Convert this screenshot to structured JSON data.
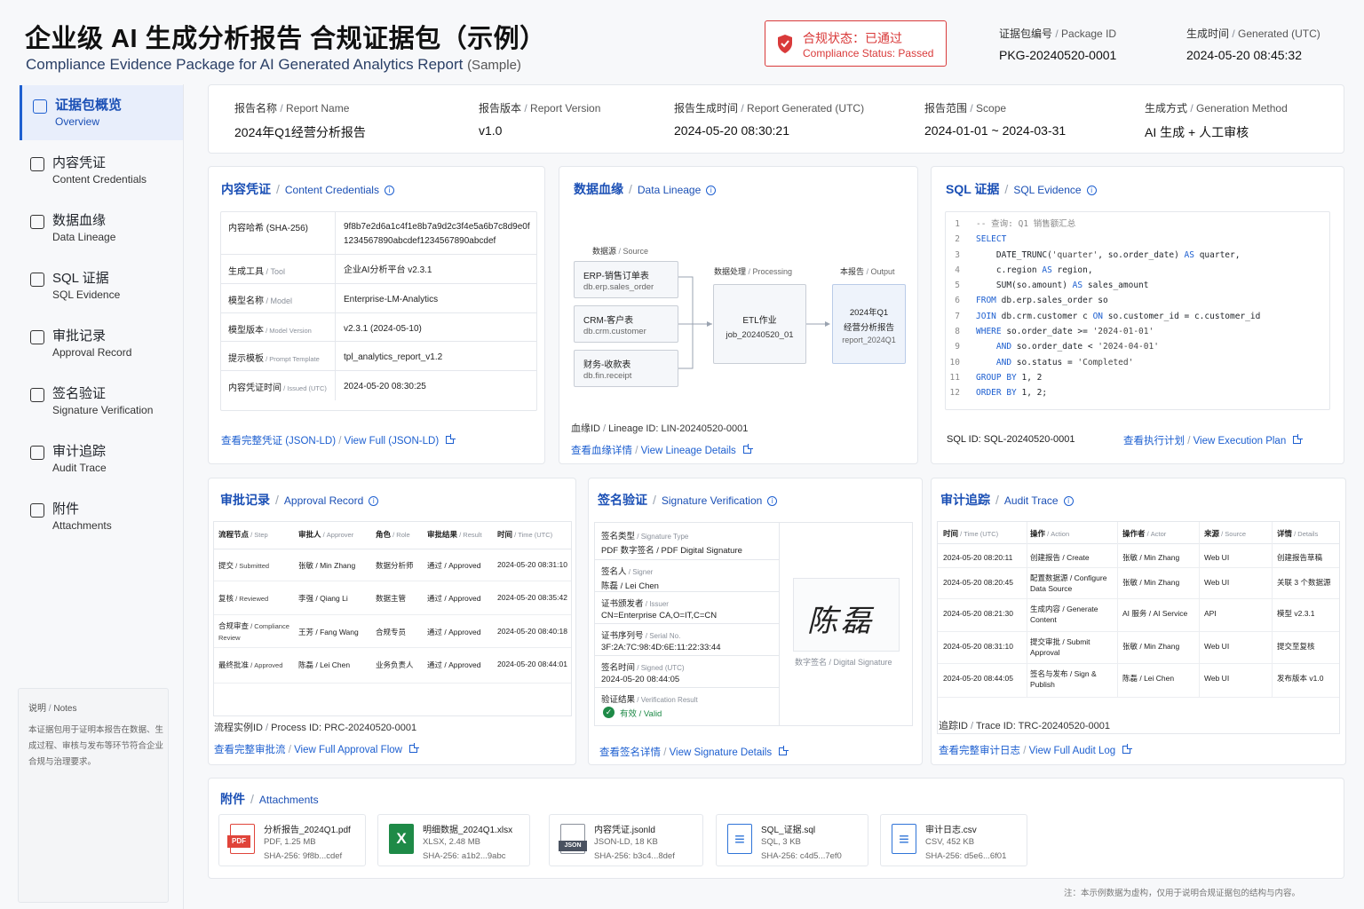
{
  "header": {
    "title_zh": "企业级 AI 生成分析报告 合规证据包（示例）",
    "title_en": "Compliance Evidence Package for AI Generated Analytics Report",
    "title_en_suffix": "(Sample)",
    "status_zh": "合规状态：已通过",
    "status_en": "Compliance Status: Passed",
    "package_id_label_zh": "证据包编号",
    "package_id_label_en": "Package ID",
    "package_id": "PKG-20240520-0001",
    "generated_label_zh": "生成时间",
    "generated_label_en": "Generated (UTC)",
    "generated": "2024-05-20 08:45:32"
  },
  "sidebar": {
    "items": [
      {
        "zh": "证据包概览",
        "en": "Overview",
        "icon": "home-icon"
      },
      {
        "zh": "内容凭证",
        "en": "Content Credentials",
        "icon": "shield-icon"
      },
      {
        "zh": "数据血缘",
        "en": "Data Lineage",
        "icon": "lineage-icon"
      },
      {
        "zh": "SQL 证据",
        "en": "SQL Evidence",
        "icon": "code-icon"
      },
      {
        "zh": "审批记录",
        "en": "Approval Record",
        "icon": "check-icon"
      },
      {
        "zh": "签名验证",
        "en": "Signature Verification",
        "icon": "pen-icon"
      },
      {
        "zh": "审计追踪",
        "en": "Audit Trace",
        "icon": "file-icon"
      },
      {
        "zh": "附件",
        "en": "Attachments",
        "icon": "paperclip-icon"
      }
    ],
    "notes_title_zh": "说明",
    "notes_title_en": "Notes",
    "notes_text": "本证据包用于证明本报告在数据、生成过程、审核与发布等环节符合企业合规与治理要求。"
  },
  "summary": [
    {
      "label_zh": "报告名称",
      "label_en": "Report Name",
      "value": "2024年Q1经营分析报告"
    },
    {
      "label_zh": "报告版本",
      "label_en": "Report Version",
      "value": "v1.0"
    },
    {
      "label_zh": "报告生成时间",
      "label_en": "Report Generated (UTC)",
      "value": "2024-05-20 08:30:21"
    },
    {
      "label_zh": "报告范围",
      "label_en": "Scope",
      "value": "2024-01-01 ~ 2024-03-31"
    },
    {
      "label_zh": "生成方式",
      "label_en": "Generation Method",
      "value": "AI 生成 + 人工审核"
    }
  ],
  "credentials": {
    "title_zh": "内容凭证",
    "title_en": "Content Credentials",
    "rows": [
      {
        "k": "内容哈希 (SHA-256)",
        "k_en": "",
        "v": "9f8b7e2d6a1c4f1e8b7a9d2c3f4e5a6b7c8d9e0f",
        "v2": "1234567890abcdef1234567890abcdef"
      },
      {
        "k": "生成工具",
        "k_en": "Tool",
        "v": "企业AI分析平台 v2.3.1"
      },
      {
        "k": "模型名称",
        "k_en": "Model",
        "v": "Enterprise-LM-Analytics"
      },
      {
        "k": "模型版本",
        "k_en": "Model Version",
        "v": "v2.3.1 (2024-05-10)"
      },
      {
        "k": "提示模板",
        "k_en": "Prompt Template",
        "v": "tpl_analytics_report_v1.2"
      },
      {
        "k": "内容凭证时间",
        "k_en": "Issued (UTC)",
        "v": "2024-05-20 08:30:25"
      }
    ],
    "link_zh": "查看完整凭证 (JSON-LD)",
    "link_en": "View Full (JSON-LD)"
  },
  "lineage": {
    "title_zh": "数据血缘",
    "title_en": "Data Lineage",
    "source_label_zh": "数据源",
    "source_label_en": "Source",
    "processing_label_zh": "数据处理",
    "processing_label_en": "Processing",
    "output_label_zh": "本报告",
    "output_label_en": "Output",
    "sources": [
      {
        "name": "ERP-销售订单表",
        "table": "db.erp.sales_order"
      },
      {
        "name": "CRM-客户表",
        "table": "db.crm.customer"
      },
      {
        "name": "财务-收款表",
        "table": "db.fin.receipt"
      }
    ],
    "etl_name": "ETL作业",
    "etl_job": "job_20240520_01",
    "output_l1": "2024年Q1",
    "output_l2": "经营分析报告",
    "output_l3": "report_2024Q1",
    "id_label_zh": "血缘ID",
    "id_label_en": "Lineage ID:",
    "id": "LIN-20240520-0001",
    "link_zh": "查看血缘详情",
    "link_en": "View Lineage Details"
  },
  "sql": {
    "title_zh": "SQL 证据",
    "title_en": "SQL Evidence",
    "lines": [
      "-- 查询: Q1 销售额汇总",
      "SELECT",
      "    DATE_TRUNC('quarter', so.order_date) AS quarter,",
      "    c.region AS region,",
      "    SUM(so.amount) AS sales_amount",
      "FROM db.erp.sales_order so",
      "JOIN db.crm.customer c ON so.customer_id = c.customer_id",
      "WHERE so.order_date >= '2024-01-01'",
      "    AND so.order_date < '2024-04-01'",
      "    AND so.status = 'Completed'",
      "GROUP BY 1, 2",
      "ORDER BY 1, 2;"
    ],
    "id_label": "SQL ID:",
    "id": "SQL-20240520-0001",
    "link_zh": "查看执行计划",
    "link_en": "View Execution Plan"
  },
  "approval": {
    "title_zh": "审批记录",
    "title_en": "Approval Record",
    "headers": [
      {
        "zh": "流程节点",
        "en": "Step"
      },
      {
        "zh": "审批人",
        "en": "Approver"
      },
      {
        "zh": "角色",
        "en": "Role"
      },
      {
        "zh": "审批结果",
        "en": "Result"
      },
      {
        "zh": "时间",
        "en": "Time (UTC)"
      }
    ],
    "rows": [
      {
        "step": "提交",
        "step_en": "Submitted",
        "approver": "张敏 / Min Zhang",
        "role": "数据分析师",
        "result": "通过 / Approved",
        "time": "2024-05-20 08:31:10"
      },
      {
        "step": "复核",
        "step_en": "Reviewed",
        "approver": "李强 / Qiang Li",
        "role": "数据主管",
        "result": "通过 / Approved",
        "time": "2024-05-20 08:35:42"
      },
      {
        "step": "合规审查",
        "step_en": "Compliance Review",
        "approver": "王芳 / Fang Wang",
        "role": "合规专员",
        "result": "通过 / Approved",
        "time": "2024-05-20 08:40:18"
      },
      {
        "step": "最终批准",
        "step_en": "Approved",
        "approver": "陈磊 / Lei Chen",
        "role": "业务负责人",
        "result": "通过 / Approved",
        "time": "2024-05-20 08:44:01"
      }
    ],
    "id_label_zh": "流程实例ID",
    "id_label_en": "Process ID:",
    "id": "PRC-20240520-0001",
    "link_zh": "查看完整审批流",
    "link_en": "View Full Approval Flow"
  },
  "signature": {
    "title_zh": "签名验证",
    "title_en": "Signature Verification",
    "fields": [
      {
        "k": "签名类型",
        "k_en": "Signature Type",
        "v": "PDF 数字签名 / PDF Digital Signature"
      },
      {
        "k": "签名人",
        "k_en": "Signer",
        "v": "陈磊 / Lei Chen"
      },
      {
        "k": "证书颁发者",
        "k_en": "Issuer",
        "v": "CN=Enterprise CA,O=IT,C=CN"
      },
      {
        "k": "证书序列号",
        "k_en": "Serial No.",
        "v": "3F:2A:7C:98:4D:6E:11:22:33:44"
      },
      {
        "k": "签名时间",
        "k_en": "Signed (UTC)",
        "v": "2024-05-20 08:44:05"
      },
      {
        "k": "验证结果",
        "k_en": "Verification Result",
        "v": "有效 / Valid"
      }
    ],
    "signature_image_text": "陈磊",
    "signature_caption": "数字签名 / Digital Signature",
    "link_zh": "查看签名详情",
    "link_en": "View Signature Details"
  },
  "audit": {
    "title_zh": "审计追踪",
    "title_en": "Audit Trace",
    "headers": [
      {
        "zh": "时间",
        "en": "Time (UTC)"
      },
      {
        "zh": "操作",
        "en": "Action"
      },
      {
        "zh": "操作者",
        "en": "Actor"
      },
      {
        "zh": "来源",
        "en": "Source"
      },
      {
        "zh": "详情",
        "en": "Details"
      }
    ],
    "rows": [
      {
        "time": "2024-05-20 08:20:11",
        "action": "创建报告 / Create",
        "actor": "张敏 / Min Zhang",
        "source": "Web UI",
        "details": "创建报告草稿"
      },
      {
        "time": "2024-05-20 08:20:45",
        "action": "配置数据源 / Configure Data Source",
        "actor": "张敏 / Min Zhang",
        "source": "Web UI",
        "details": "关联 3 个数据源"
      },
      {
        "time": "2024-05-20 08:21:30",
        "action": "生成内容 / Generate Content",
        "actor": "AI 服务 / AI Service",
        "source": "API",
        "details": "模型 v2.3.1"
      },
      {
        "time": "2024-05-20 08:31:10",
        "action": "提交审批 / Submit Approval",
        "actor": "张敏 / Min Zhang",
        "source": "Web UI",
        "details": "提交至复核"
      },
      {
        "time": "2024-05-20 08:44:05",
        "action": "签名与发布 / Sign & Publish",
        "actor": "陈磊 / Lei Chen",
        "source": "Web UI",
        "details": "发布版本 v1.0"
      }
    ],
    "id_label_zh": "追踪ID",
    "id_label_en": "Trace ID:",
    "id": "TRC-20240520-0001",
    "link_zh": "查看完整审计日志",
    "link_en": "View Full Audit Log"
  },
  "attachments": {
    "title_zh": "附件",
    "title_en": "Attachments",
    "files": [
      {
        "name": "分析报告_2024Q1.pdf",
        "meta": "PDF, 1.25 MB",
        "hash": "SHA-256: 9f8b...cdef",
        "icon": "pdf-icon",
        "badge": "PDF",
        "color": "#e0443a"
      },
      {
        "name": "明细数据_2024Q1.xlsx",
        "meta": "XLSX, 2.48 MB",
        "hash": "SHA-256: a1b2...9abc",
        "icon": "excel-icon",
        "badge": "X",
        "color": "#1e8a47"
      },
      {
        "name": "内容凭证.jsonld",
        "meta": "JSON-LD, 18 KB",
        "hash": "SHA-256: b3c4...8def",
        "icon": "json-icon",
        "badge": "JSON",
        "color": "#4a5260"
      },
      {
        "name": "SQL_证据.sql",
        "meta": "SQL, 3 KB",
        "hash": "SHA-256: c4d5...7ef0",
        "icon": "sql-file-icon",
        "badge": "≡",
        "color": "#2f74d8"
      },
      {
        "name": "审计日志.csv",
        "meta": "CSV, 452 KB",
        "hash": "SHA-256: d5e6...6f01",
        "icon": "csv-icon",
        "badge": "≡",
        "color": "#2f74d8"
      }
    ]
  },
  "footer_note": "注：本示例数据为虚构，仅用于说明合规证据包的结构与内容。"
}
